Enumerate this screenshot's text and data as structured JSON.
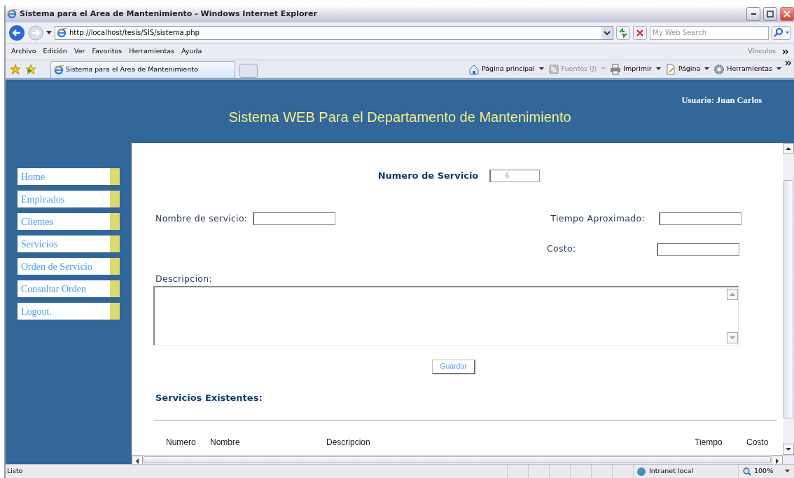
{
  "window": {
    "title": "Sistema para el Area de Mantenimiento - Windows Internet Explorer"
  },
  "address_bar": {
    "url": "http://localhost/tesis/SIS/sistema.php"
  },
  "search": {
    "placeholder": "My Web Search"
  },
  "menu": [
    "Archivo",
    "Edición",
    "Ver",
    "Favoritos",
    "Herramientas",
    "Ayuda"
  ],
  "links_label": "Vínculos",
  "tab": {
    "label": "Sistema para el Area de Mantenimiento"
  },
  "command_bar": [
    {
      "label": "Página principal",
      "kind": "home",
      "disabled": false
    },
    {
      "label": "Fuentes (J)",
      "kind": "feed",
      "disabled": true
    },
    {
      "label": "Imprimir",
      "kind": "print",
      "disabled": false
    },
    {
      "label": "Página",
      "kind": "page",
      "disabled": false
    },
    {
      "label": "Herramientas",
      "kind": "tools",
      "disabled": false
    }
  ],
  "header": {
    "title": "Sistema WEB Para el Departamento de Mantenimiento",
    "user": "Usuario: Juan Carlos"
  },
  "nav": [
    "Home",
    "Empleados",
    "Clientes",
    "Servicios",
    "Orden de Servicio",
    "Consultar Orden",
    "Logout."
  ],
  "form": {
    "number_label": "Numero de Servicio",
    "number_value": "6",
    "name_label": "Nombre de servicio:",
    "time_label": "Tiempo Aproximado:",
    "cost_label": "Costo:",
    "description_label": "Descripcion:",
    "save_button": "Guardar"
  },
  "existing": {
    "title": "Servicios Existentes:",
    "columns": [
      "Numero",
      "Nombre",
      "Descripcion",
      "Tiempo",
      "Costo"
    ]
  },
  "status_bar": {
    "text": "Listo",
    "zone": "Intranet local",
    "zoom": "100%"
  }
}
